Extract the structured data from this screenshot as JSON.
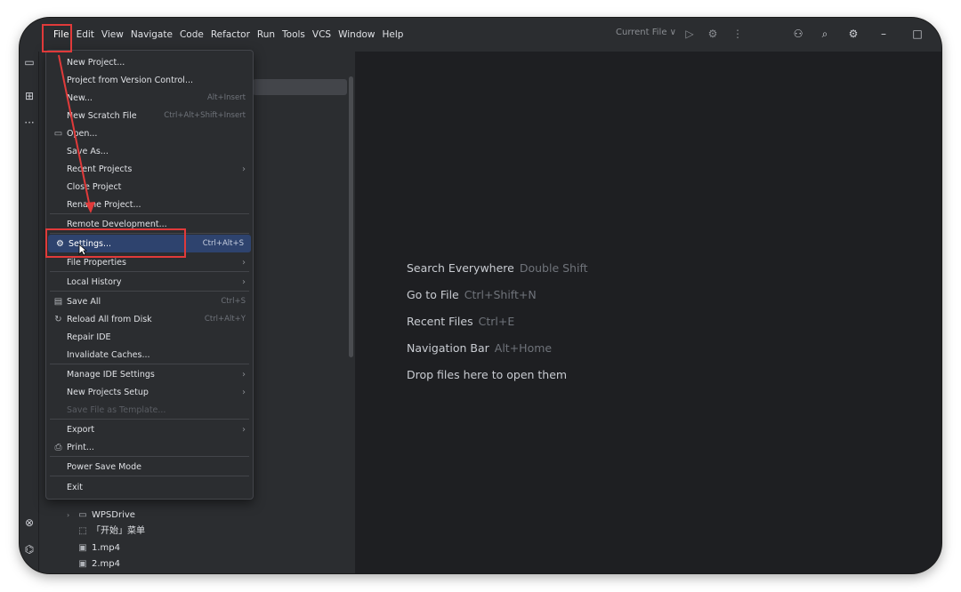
{
  "menubar": {
    "items": [
      "File",
      "Edit",
      "View",
      "Navigate",
      "Code",
      "Refactor",
      "Run",
      "Tools",
      "VCS",
      "Window",
      "Help"
    ],
    "run_config": "Current File ∨"
  },
  "file_menu": {
    "items": [
      {
        "label": "New Project...",
        "shortcut": "",
        "submenu": false
      },
      {
        "label": "Project from Version Control...",
        "shortcut": "",
        "submenu": false
      },
      {
        "label": "New...",
        "shortcut": "Alt+Insert",
        "submenu": false
      },
      {
        "label": "New Scratch File",
        "shortcut": "Ctrl+Alt+Shift+Insert",
        "submenu": false
      },
      {
        "label": "Open...",
        "shortcut": "",
        "submenu": false,
        "icon": "folder-icon"
      },
      {
        "label": "Save As...",
        "shortcut": "",
        "submenu": false
      },
      {
        "label": "Recent Projects",
        "shortcut": "",
        "submenu": true
      },
      {
        "label": "Close Project",
        "shortcut": "",
        "submenu": false
      },
      {
        "label": "Rename Project...",
        "shortcut": "",
        "submenu": false
      },
      {
        "label": "Remote Development...",
        "shortcut": "",
        "submenu": false
      },
      {
        "label": "Settings...",
        "shortcut": "Ctrl+Alt+S",
        "submenu": false,
        "icon": "gear-icon",
        "selected": true
      },
      {
        "label": "File Properties",
        "shortcut": "",
        "submenu": true
      },
      {
        "label": "Local History",
        "shortcut": "",
        "submenu": true
      },
      {
        "label": "Save All",
        "shortcut": "Ctrl+S",
        "submenu": false,
        "icon": "save-icon"
      },
      {
        "label": "Reload All from Disk",
        "shortcut": "Ctrl+Alt+Y",
        "submenu": false,
        "icon": "reload-icon"
      },
      {
        "label": "Repair IDE",
        "shortcut": "",
        "submenu": false
      },
      {
        "label": "Invalidate Caches...",
        "shortcut": "",
        "submenu": false
      },
      {
        "label": "Manage IDE Settings",
        "shortcut": "",
        "submenu": true
      },
      {
        "label": "New Projects Setup",
        "shortcut": "",
        "submenu": true
      },
      {
        "label": "Save File as Template...",
        "shortcut": "",
        "submenu": false,
        "disabled": true
      },
      {
        "label": "Export",
        "shortcut": "",
        "submenu": true
      },
      {
        "label": "Print...",
        "shortcut": "",
        "submenu": false,
        "icon": "print-icon"
      },
      {
        "label": "Power Save Mode",
        "shortcut": "",
        "submenu": false
      },
      {
        "label": "Exit",
        "shortcut": "",
        "submenu": false
      }
    ]
  },
  "project_tree": {
    "items": [
      {
        "label": "WPSDrive",
        "type": "folder"
      },
      {
        "label": "「开始」菜单",
        "type": "shortcut"
      },
      {
        "label": "1.mp4",
        "type": "file"
      },
      {
        "label": "2.mp4",
        "type": "file"
      }
    ]
  },
  "editor": {
    "hints": [
      {
        "label": "Search Everywhere",
        "shortcut": "Double Shift"
      },
      {
        "label": "Go to File",
        "shortcut": "Ctrl+Shift+N"
      },
      {
        "label": "Recent Files",
        "shortcut": "Ctrl+E"
      },
      {
        "label": "Navigation Bar",
        "shortcut": "Alt+Home"
      },
      {
        "label": "Drop files here to open them",
        "shortcut": ""
      }
    ]
  },
  "colors": {
    "background": "#2b2d30",
    "editor": "#1e1f22",
    "selection": "#2e436e",
    "annotation": "#e03a3a"
  }
}
